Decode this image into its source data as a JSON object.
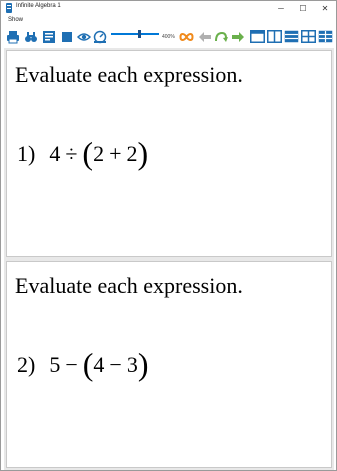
{
  "window": {
    "title": "Infinite Algebra 1",
    "controls": {
      "minimize": "─",
      "maximize": "☐",
      "close": "✕"
    }
  },
  "menu": {
    "show": "Show"
  },
  "toolbar": {
    "zoom_label": "400%",
    "icons": [
      "printer-icon",
      "binoculars-icon",
      "dataset-icon",
      "stop-icon",
      "eye-icon",
      "speedometer-icon",
      "infinity-icon",
      "back-arrow-icon",
      "undo-arrow-icon",
      "forward-arrow-icon",
      "layout-one-column-icon",
      "layout-two-column-icon",
      "layout-rows-icon",
      "layout-grid-icon",
      "layout-mixed-icon"
    ],
    "colors": {
      "blue": "#1f6fb3",
      "orange": "#f08a1c",
      "green": "#6ab04c",
      "gray": "#b0b0b0"
    }
  },
  "pages": [
    {
      "instruction": "Evaluate each expression.",
      "number": "1)",
      "expr": {
        "a": "4",
        "op": "÷",
        "lparen": "(",
        "b": "2",
        "op2": "+",
        "c": "2",
        "rparen": ")"
      }
    },
    {
      "instruction": "Evaluate each expression.",
      "number": "2)",
      "expr": {
        "a": "5",
        "op": "−",
        "lparen": "(",
        "b": "4",
        "op2": "−",
        "c": "3",
        "rparen": ")"
      }
    }
  ]
}
